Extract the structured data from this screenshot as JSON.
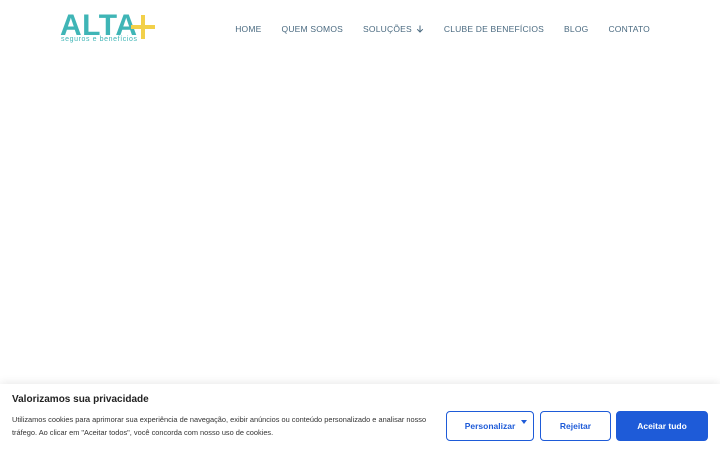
{
  "header": {
    "logo": {
      "word": "ALTA",
      "tagline": "seguros e benefícios",
      "color": "#3fb5b6",
      "plus_color": "#f2d04a"
    },
    "nav": [
      {
        "label": "HOME"
      },
      {
        "label": "QUEM SOMOS"
      },
      {
        "label": "SOLUÇÕES",
        "icon": "chevron-down-icon"
      },
      {
        "label": "CLUBE DE BENEFÍCIOS"
      },
      {
        "label": "BLOG"
      },
      {
        "label": "CONTATO"
      }
    ]
  },
  "cookie_banner": {
    "title": "Valorizamos sua privacidade",
    "text": "Utilizamos cookies para aprimorar sua experiência de navegação, exibir anúncios ou conteúdo personalizado e analisar nosso tráfego. Ao clicar em \"Aceitar todos\", você concorda com nosso uso de cookies.",
    "buttons": {
      "customize": "Personalizar",
      "reject": "Rejeitar",
      "accept": "Aceitar tudo"
    },
    "accent_color": "#1e5bd8"
  }
}
